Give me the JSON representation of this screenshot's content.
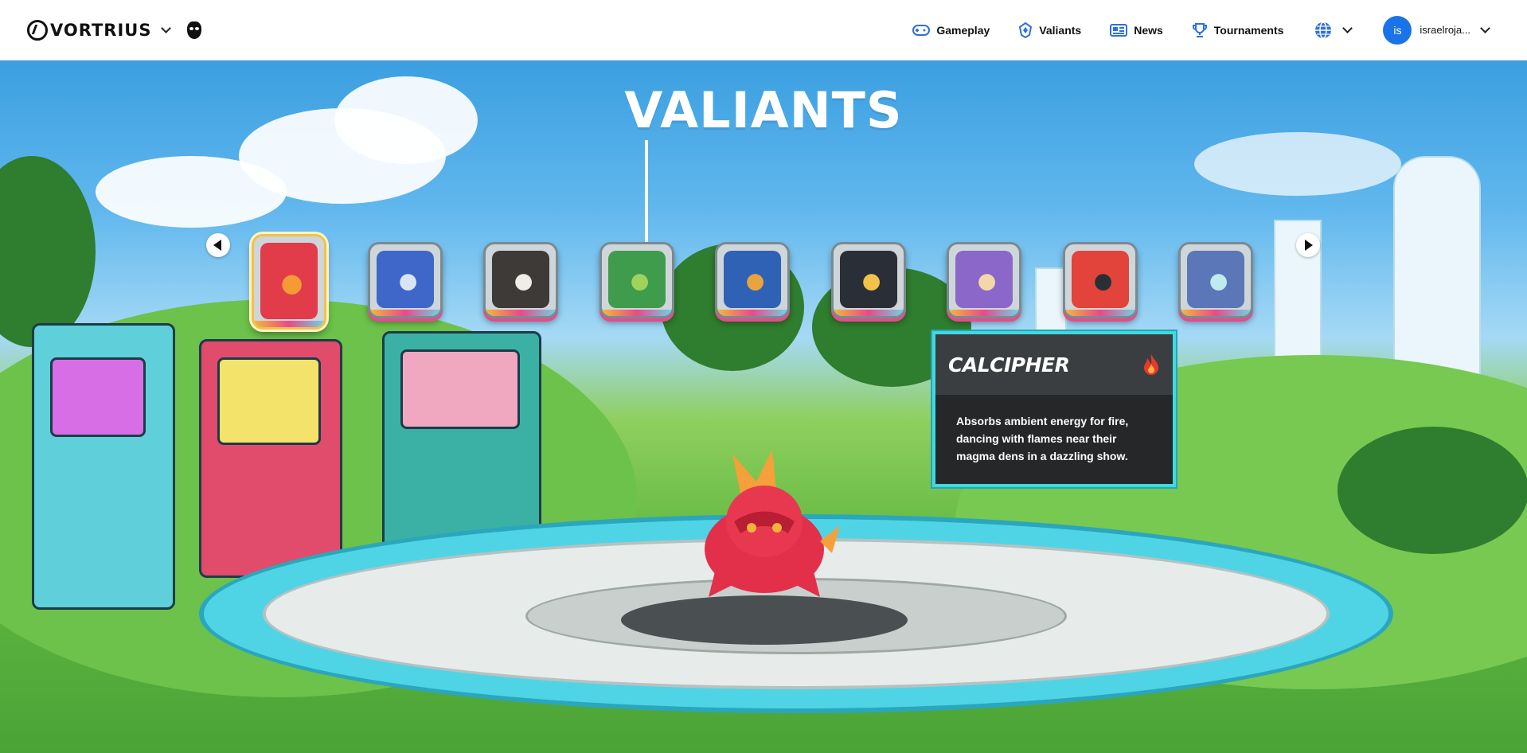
{
  "nav": {
    "brand": "VORTRIUS",
    "links": [
      {
        "label": "Gameplay",
        "icon": "gamepad-icon"
      },
      {
        "label": "Valiants",
        "icon": "valiant-icon"
      },
      {
        "label": "News",
        "icon": "news-icon"
      },
      {
        "label": "Tournaments",
        "icon": "trophy-icon"
      }
    ],
    "user": {
      "initials": "is",
      "name": "israelroja..."
    },
    "colors": {
      "accent": "#1a73e8"
    }
  },
  "hero": {
    "title": "VALIANTS",
    "valiants": [
      {
        "color": "#e23b4a",
        "accent": "#f59a35",
        "active": true
      },
      {
        "color": "#3f67c9",
        "accent": "#d9e4f5",
        "active": false
      },
      {
        "color": "#3d3a38",
        "accent": "#f0ede8",
        "active": false
      },
      {
        "color": "#3f9c4c",
        "accent": "#9fd35c",
        "active": false
      },
      {
        "color": "#2f62b5",
        "accent": "#e9a43d",
        "active": false
      },
      {
        "color": "#2a2e36",
        "accent": "#f2c24a",
        "active": false
      },
      {
        "color": "#8a67c8",
        "accent": "#f2d8a8",
        "active": false
      },
      {
        "color": "#e2433a",
        "accent": "#2a2e36",
        "active": false
      },
      {
        "color": "#5b77b7",
        "accent": "#bfeaf0",
        "active": false
      }
    ],
    "selected": {
      "name": "CALCIPHER",
      "element_icon": "fire-icon",
      "description": "Absorbs ambient energy for fire, dancing with flames near their magma dens in a dazzling show."
    },
    "colors": {
      "frame": "#41d8e0",
      "panel": "#252729"
    }
  }
}
